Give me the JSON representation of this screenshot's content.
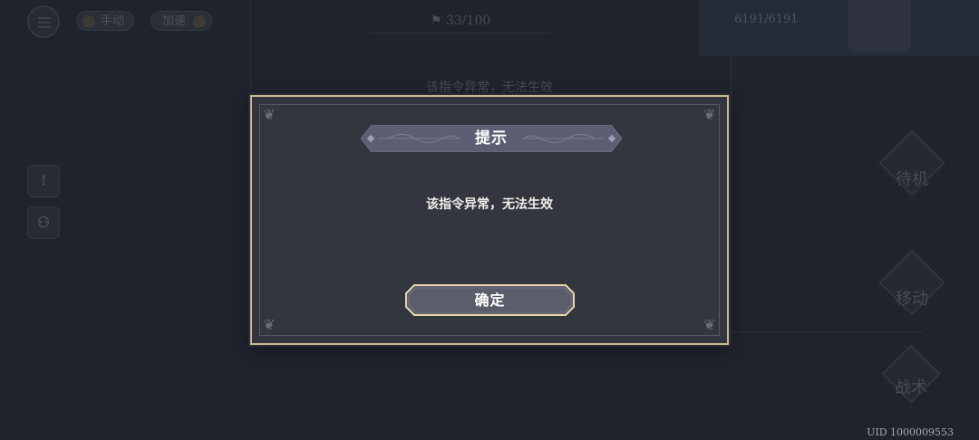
{
  "hud": {
    "mode_manual": "手动",
    "mode_speed": "加速",
    "turn_counter": "33/100",
    "hp_value": "6191/6191",
    "bg_message": "该指令异常，无法生效",
    "side_alert": "!",
    "action_standby": "待机",
    "action_move": "移动",
    "action_tactics": "战术"
  },
  "dialog": {
    "title": "提示",
    "message": "该指令异常，无法生效",
    "confirm_label": "确定"
  },
  "footer": {
    "uid": "UID 1000009553"
  },
  "colors": {
    "background": "#1f232e",
    "dialog_background": "#33353f",
    "dialog_border": "#c9b98f",
    "title_banner": "#5c5f74",
    "confirm_button": "#5b5d6b",
    "text_primary": "#ffffff"
  }
}
